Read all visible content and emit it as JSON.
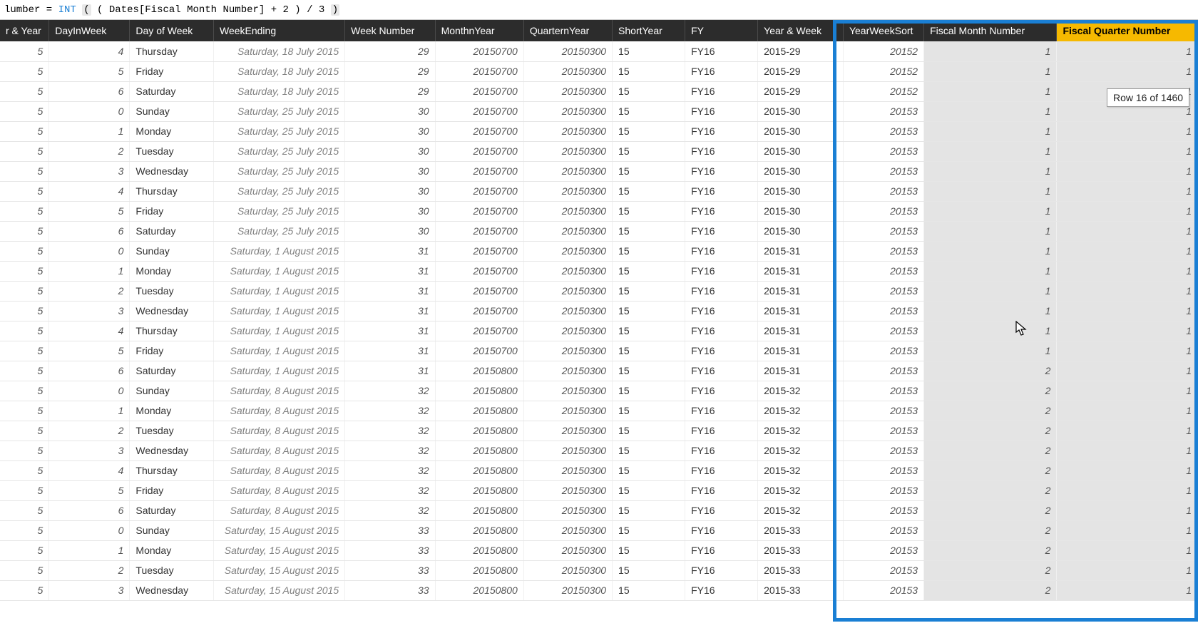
{
  "formula": {
    "lhs": "lumber = ",
    "fn": "INT",
    "open": "(",
    "mid": " ( Dates[Fiscal Month Number] + 2 ) / 3 ",
    "close": ")"
  },
  "tooltip": "Row 16 of 1460",
  "columns": [
    {
      "key": "year",
      "label": "r & Year",
      "cls": ""
    },
    {
      "key": "diw",
      "label": "DayInWeek",
      "cls": "num"
    },
    {
      "key": "dow",
      "label": "Day of Week",
      "cls": ""
    },
    {
      "key": "wend",
      "label": "WeekEnding",
      "cls": ""
    },
    {
      "key": "wnum",
      "label": "Week Number",
      "cls": "num"
    },
    {
      "key": "mny",
      "label": "MonthnYear",
      "cls": "num"
    },
    {
      "key": "qny",
      "label": "QuarternYear",
      "cls": "num"
    },
    {
      "key": "sy",
      "label": "ShortYear",
      "cls": ""
    },
    {
      "key": "fy",
      "label": "FY",
      "cls": ""
    },
    {
      "key": "yw",
      "label": "Year & Week",
      "cls": ""
    },
    {
      "key": "yws",
      "label": "YearWeekSort",
      "cls": "num"
    },
    {
      "key": "fmn",
      "label": "Fiscal Month Number",
      "cls": "num"
    },
    {
      "key": "fqn",
      "label": "Fiscal Quarter Number",
      "cls": "num"
    }
  ],
  "active_column": "fqn",
  "rows": [
    {
      "year": "5",
      "diw": "4",
      "dow": "Thursday",
      "wend": "Saturday, 18 July 2015",
      "wnum": "29",
      "mny": "20150700",
      "qny": "20150300",
      "sy": "15",
      "fy": "FY16",
      "yw": "2015-29",
      "yws": "20152",
      "fmn": "1",
      "fqn": "1"
    },
    {
      "year": "5",
      "diw": "5",
      "dow": "Friday",
      "wend": "Saturday, 18 July 2015",
      "wnum": "29",
      "mny": "20150700",
      "qny": "20150300",
      "sy": "15",
      "fy": "FY16",
      "yw": "2015-29",
      "yws": "20152",
      "fmn": "1",
      "fqn": "1"
    },
    {
      "year": "5",
      "diw": "6",
      "dow": "Saturday",
      "wend": "Saturday, 18 July 2015",
      "wnum": "29",
      "mny": "20150700",
      "qny": "20150300",
      "sy": "15",
      "fy": "FY16",
      "yw": "2015-29",
      "yws": "20152",
      "fmn": "1",
      "fqn": "1"
    },
    {
      "year": "5",
      "diw": "0",
      "dow": "Sunday",
      "wend": "Saturday, 25 July 2015",
      "wnum": "30",
      "mny": "20150700",
      "qny": "20150300",
      "sy": "15",
      "fy": "FY16",
      "yw": "2015-30",
      "yws": "20153",
      "fmn": "1",
      "fqn": "1"
    },
    {
      "year": "5",
      "diw": "1",
      "dow": "Monday",
      "wend": "Saturday, 25 July 2015",
      "wnum": "30",
      "mny": "20150700",
      "qny": "20150300",
      "sy": "15",
      "fy": "FY16",
      "yw": "2015-30",
      "yws": "20153",
      "fmn": "1",
      "fqn": "1"
    },
    {
      "year": "5",
      "diw": "2",
      "dow": "Tuesday",
      "wend": "Saturday, 25 July 2015",
      "wnum": "30",
      "mny": "20150700",
      "qny": "20150300",
      "sy": "15",
      "fy": "FY16",
      "yw": "2015-30",
      "yws": "20153",
      "fmn": "1",
      "fqn": "1"
    },
    {
      "year": "5",
      "diw": "3",
      "dow": "Wednesday",
      "wend": "Saturday, 25 July 2015",
      "wnum": "30",
      "mny": "20150700",
      "qny": "20150300",
      "sy": "15",
      "fy": "FY16",
      "yw": "2015-30",
      "yws": "20153",
      "fmn": "1",
      "fqn": "1"
    },
    {
      "year": "5",
      "diw": "4",
      "dow": "Thursday",
      "wend": "Saturday, 25 July 2015",
      "wnum": "30",
      "mny": "20150700",
      "qny": "20150300",
      "sy": "15",
      "fy": "FY16",
      "yw": "2015-30",
      "yws": "20153",
      "fmn": "1",
      "fqn": "1"
    },
    {
      "year": "5",
      "diw": "5",
      "dow": "Friday",
      "wend": "Saturday, 25 July 2015",
      "wnum": "30",
      "mny": "20150700",
      "qny": "20150300",
      "sy": "15",
      "fy": "FY16",
      "yw": "2015-30",
      "yws": "20153",
      "fmn": "1",
      "fqn": "1"
    },
    {
      "year": "5",
      "diw": "6",
      "dow": "Saturday",
      "wend": "Saturday, 25 July 2015",
      "wnum": "30",
      "mny": "20150700",
      "qny": "20150300",
      "sy": "15",
      "fy": "FY16",
      "yw": "2015-30",
      "yws": "20153",
      "fmn": "1",
      "fqn": "1"
    },
    {
      "year": "5",
      "diw": "0",
      "dow": "Sunday",
      "wend": "Saturday, 1 August 2015",
      "wnum": "31",
      "mny": "20150700",
      "qny": "20150300",
      "sy": "15",
      "fy": "FY16",
      "yw": "2015-31",
      "yws": "20153",
      "fmn": "1",
      "fqn": "1"
    },
    {
      "year": "5",
      "diw": "1",
      "dow": "Monday",
      "wend": "Saturday, 1 August 2015",
      "wnum": "31",
      "mny": "20150700",
      "qny": "20150300",
      "sy": "15",
      "fy": "FY16",
      "yw": "2015-31",
      "yws": "20153",
      "fmn": "1",
      "fqn": "1"
    },
    {
      "year": "5",
      "diw": "2",
      "dow": "Tuesday",
      "wend": "Saturday, 1 August 2015",
      "wnum": "31",
      "mny": "20150700",
      "qny": "20150300",
      "sy": "15",
      "fy": "FY16",
      "yw": "2015-31",
      "yws": "20153",
      "fmn": "1",
      "fqn": "1"
    },
    {
      "year": "5",
      "diw": "3",
      "dow": "Wednesday",
      "wend": "Saturday, 1 August 2015",
      "wnum": "31",
      "mny": "20150700",
      "qny": "20150300",
      "sy": "15",
      "fy": "FY16",
      "yw": "2015-31",
      "yws": "20153",
      "fmn": "1",
      "fqn": "1"
    },
    {
      "year": "5",
      "diw": "4",
      "dow": "Thursday",
      "wend": "Saturday, 1 August 2015",
      "wnum": "31",
      "mny": "20150700",
      "qny": "20150300",
      "sy": "15",
      "fy": "FY16",
      "yw": "2015-31",
      "yws": "20153",
      "fmn": "1",
      "fqn": "1"
    },
    {
      "year": "5",
      "diw": "5",
      "dow": "Friday",
      "wend": "Saturday, 1 August 2015",
      "wnum": "31",
      "mny": "20150700",
      "qny": "20150300",
      "sy": "15",
      "fy": "FY16",
      "yw": "2015-31",
      "yws": "20153",
      "fmn": "1",
      "fqn": "1"
    },
    {
      "year": "5",
      "diw": "6",
      "dow": "Saturday",
      "wend": "Saturday, 1 August 2015",
      "wnum": "31",
      "mny": "20150800",
      "qny": "20150300",
      "sy": "15",
      "fy": "FY16",
      "yw": "2015-31",
      "yws": "20153",
      "fmn": "2",
      "fqn": "1"
    },
    {
      "year": "5",
      "diw": "0",
      "dow": "Sunday",
      "wend": "Saturday, 8 August 2015",
      "wnum": "32",
      "mny": "20150800",
      "qny": "20150300",
      "sy": "15",
      "fy": "FY16",
      "yw": "2015-32",
      "yws": "20153",
      "fmn": "2",
      "fqn": "1"
    },
    {
      "year": "5",
      "diw": "1",
      "dow": "Monday",
      "wend": "Saturday, 8 August 2015",
      "wnum": "32",
      "mny": "20150800",
      "qny": "20150300",
      "sy": "15",
      "fy": "FY16",
      "yw": "2015-32",
      "yws": "20153",
      "fmn": "2",
      "fqn": "1"
    },
    {
      "year": "5",
      "diw": "2",
      "dow": "Tuesday",
      "wend": "Saturday, 8 August 2015",
      "wnum": "32",
      "mny": "20150800",
      "qny": "20150300",
      "sy": "15",
      "fy": "FY16",
      "yw": "2015-32",
      "yws": "20153",
      "fmn": "2",
      "fqn": "1"
    },
    {
      "year": "5",
      "diw": "3",
      "dow": "Wednesday",
      "wend": "Saturday, 8 August 2015",
      "wnum": "32",
      "mny": "20150800",
      "qny": "20150300",
      "sy": "15",
      "fy": "FY16",
      "yw": "2015-32",
      "yws": "20153",
      "fmn": "2",
      "fqn": "1"
    },
    {
      "year": "5",
      "diw": "4",
      "dow": "Thursday",
      "wend": "Saturday, 8 August 2015",
      "wnum": "32",
      "mny": "20150800",
      "qny": "20150300",
      "sy": "15",
      "fy": "FY16",
      "yw": "2015-32",
      "yws": "20153",
      "fmn": "2",
      "fqn": "1"
    },
    {
      "year": "5",
      "diw": "5",
      "dow": "Friday",
      "wend": "Saturday, 8 August 2015",
      "wnum": "32",
      "mny": "20150800",
      "qny": "20150300",
      "sy": "15",
      "fy": "FY16",
      "yw": "2015-32",
      "yws": "20153",
      "fmn": "2",
      "fqn": "1"
    },
    {
      "year": "5",
      "diw": "6",
      "dow": "Saturday",
      "wend": "Saturday, 8 August 2015",
      "wnum": "32",
      "mny": "20150800",
      "qny": "20150300",
      "sy": "15",
      "fy": "FY16",
      "yw": "2015-32",
      "yws": "20153",
      "fmn": "2",
      "fqn": "1"
    },
    {
      "year": "5",
      "diw": "0",
      "dow": "Sunday",
      "wend": "Saturday, 15 August 2015",
      "wnum": "33",
      "mny": "20150800",
      "qny": "20150300",
      "sy": "15",
      "fy": "FY16",
      "yw": "2015-33",
      "yws": "20153",
      "fmn": "2",
      "fqn": "1"
    },
    {
      "year": "5",
      "diw": "1",
      "dow": "Monday",
      "wend": "Saturday, 15 August 2015",
      "wnum": "33",
      "mny": "20150800",
      "qny": "20150300",
      "sy": "15",
      "fy": "FY16",
      "yw": "2015-33",
      "yws": "20153",
      "fmn": "2",
      "fqn": "1"
    },
    {
      "year": "5",
      "diw": "2",
      "dow": "Tuesday",
      "wend": "Saturday, 15 August 2015",
      "wnum": "33",
      "mny": "20150800",
      "qny": "20150300",
      "sy": "15",
      "fy": "FY16",
      "yw": "2015-33",
      "yws": "20153",
      "fmn": "2",
      "fqn": "1"
    },
    {
      "year": "5",
      "diw": "3",
      "dow": "Wednesday",
      "wend": "Saturday, 15 August 2015",
      "wnum": "33",
      "mny": "20150800",
      "qny": "20150300",
      "sy": "15",
      "fy": "FY16",
      "yw": "2015-33",
      "yws": "20153",
      "fmn": "2",
      "fqn": "1"
    }
  ]
}
